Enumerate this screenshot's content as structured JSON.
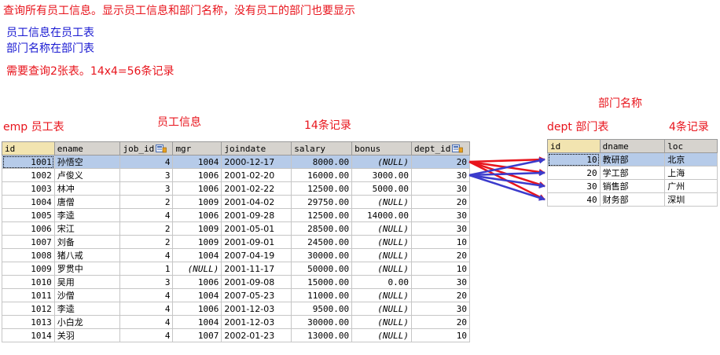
{
  "notes": {
    "line1": "查询所有员工信息。显示员工信息和部门名称，没有员工的部门也要显示",
    "line2": "员工信息在员工表",
    "line3": "部门名称在部门表",
    "line4": "需要查询2张表。14x4=56条记录"
  },
  "labels": {
    "emp_table": "emp 员工表",
    "emp_info": "员工信息",
    "emp_count": "14条记录",
    "dept_name": "部门名称",
    "dept_table": "dept 部门表",
    "dept_count": "4条记录"
  },
  "colors": {
    "red": "#e8141c",
    "blue": "#1a1ad2",
    "arrow_red": "#e8141c",
    "arrow_blue": "#3b3bcc"
  },
  "emp": {
    "columns": [
      "id",
      "ename",
      "job_id",
      "mgr",
      "joindate",
      "salary",
      "bonus",
      "dept_id"
    ],
    "rows": [
      [
        "1001",
        "孙悟空",
        "4",
        "1004",
        "2000-12-17",
        "8000.00",
        "(NULL)",
        "20"
      ],
      [
        "1002",
        "卢俊义",
        "3",
        "1006",
        "2001-02-20",
        "16000.00",
        "3000.00",
        "30"
      ],
      [
        "1003",
        "林冲",
        "3",
        "1006",
        "2001-02-22",
        "12500.00",
        "5000.00",
        "30"
      ],
      [
        "1004",
        "唐僧",
        "2",
        "1009",
        "2001-04-02",
        "29750.00",
        "(NULL)",
        "20"
      ],
      [
        "1005",
        "李逵",
        "4",
        "1006",
        "2001-09-28",
        "12500.00",
        "14000.00",
        "30"
      ],
      [
        "1006",
        "宋江",
        "2",
        "1009",
        "2001-05-01",
        "28500.00",
        "(NULL)",
        "30"
      ],
      [
        "1007",
        "刘备",
        "2",
        "1009",
        "2001-09-01",
        "24500.00",
        "(NULL)",
        "10"
      ],
      [
        "1008",
        "猪八戒",
        "4",
        "1004",
        "2007-04-19",
        "30000.00",
        "(NULL)",
        "20"
      ],
      [
        "1009",
        "罗贯中",
        "1",
        "(NULL)",
        "2001-11-17",
        "50000.00",
        "(NULL)",
        "10"
      ],
      [
        "1010",
        "吴用",
        "3",
        "1006",
        "2001-09-08",
        "15000.00",
        "0.00",
        "30"
      ],
      [
        "1011",
        "沙僧",
        "4",
        "1004",
        "2007-05-23",
        "11000.00",
        "(NULL)",
        "20"
      ],
      [
        "1012",
        "李逵",
        "4",
        "1006",
        "2001-12-03",
        "9500.00",
        "(NULL)",
        "30"
      ],
      [
        "1013",
        "小白龙",
        "4",
        "1004",
        "2001-12-03",
        "30000.00",
        "(NULL)",
        "20"
      ],
      [
        "1014",
        "关羽",
        "4",
        "1007",
        "2002-01-23",
        "13000.00",
        "(NULL)",
        "10"
      ]
    ]
  },
  "dept": {
    "columns": [
      "id",
      "dname",
      "loc"
    ],
    "rows": [
      [
        "10",
        "教研部",
        "北京"
      ],
      [
        "20",
        "学工部",
        "上海"
      ],
      [
        "30",
        "销售部",
        "广州"
      ],
      [
        "40",
        "财务部",
        "深圳"
      ]
    ]
  }
}
